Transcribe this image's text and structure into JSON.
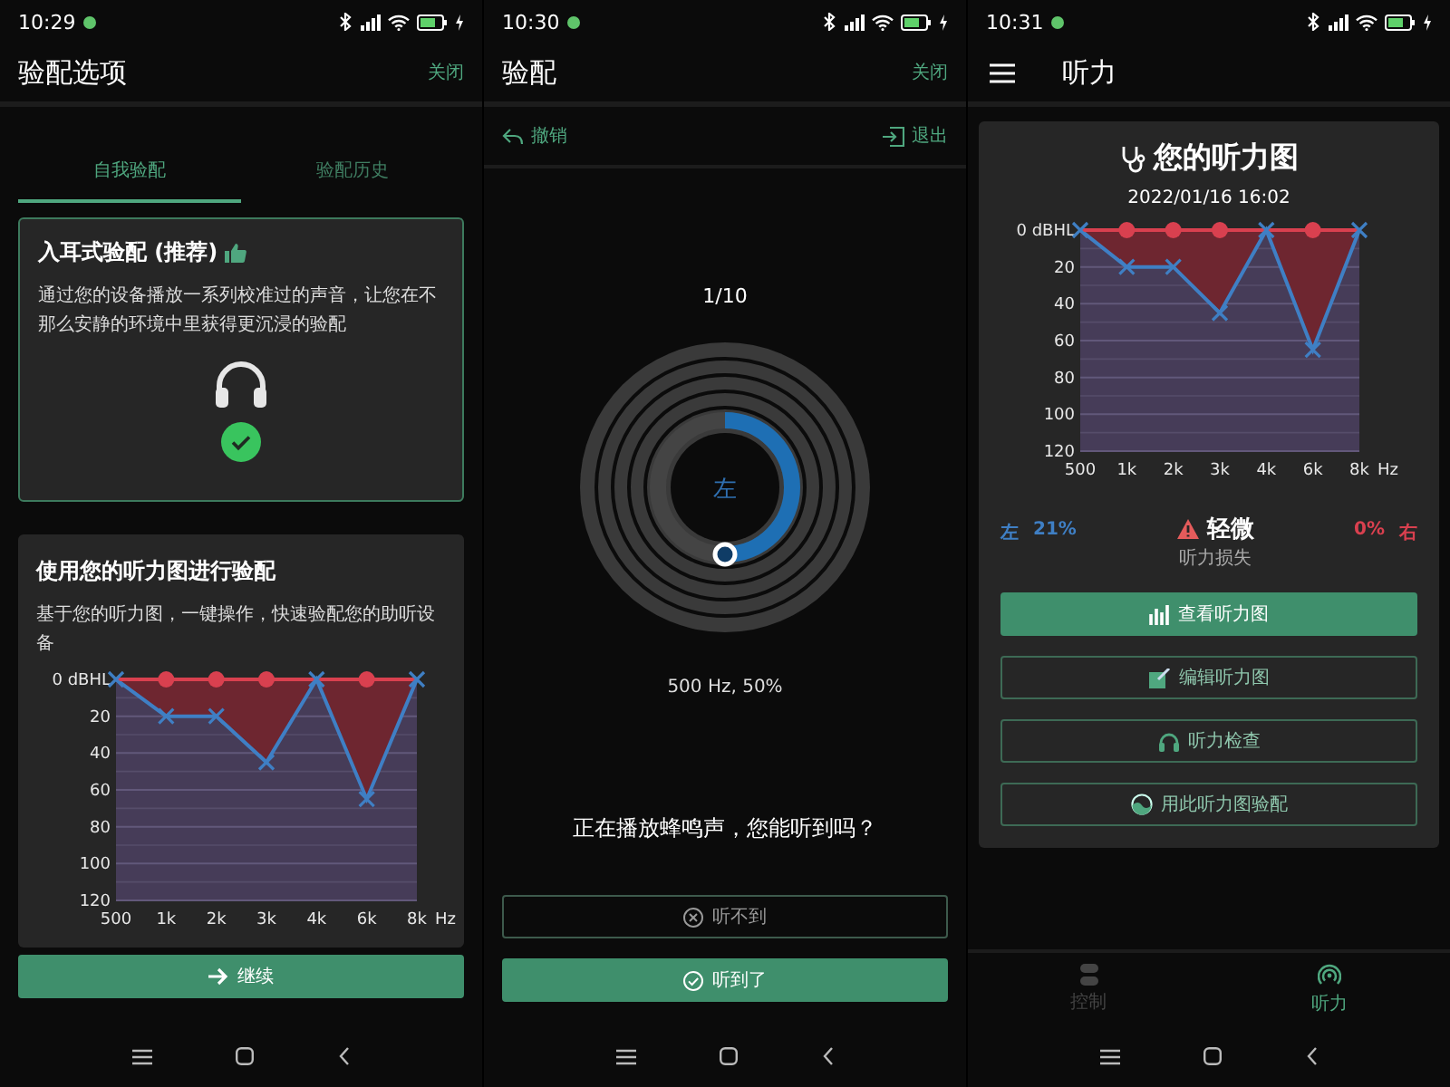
{
  "screens": [
    {
      "kind": "fitting_options",
      "status_bar": {
        "time": "10:29"
      },
      "header": {
        "title": "验配选项",
        "action": "关闭"
      },
      "tabs": [
        {
          "label": "自我验配",
          "selected": true
        },
        {
          "label": "验配历史",
          "selected": false
        }
      ],
      "option_card": {
        "title": "入耳式验配 (推荐)",
        "description": "通过您的设备播放一系列校准过的声音，让您在不那么安静的环境中里获得更沉浸的验配",
        "selected": true
      },
      "audiogram_card": {
        "title": "使用您的听力图进行验配",
        "description": "基于您的听力图，一键操作，快速验配您的助听设备",
        "chart_data": {
          "type": "line",
          "xlabel": "Hz",
          "categories": [
            "500",
            "1k",
            "2k",
            "3k",
            "4k",
            "6k",
            "8k"
          ],
          "series": [
            {
              "color": "#3f7fc4",
              "marker": "cross",
              "values": [
                0,
                20,
                20,
                45,
                0,
                65,
                0
              ]
            },
            {
              "color": "#d9404f",
              "marker": "circle",
              "values": [
                0,
                0,
                0,
                0,
                0,
                0,
                0
              ]
            }
          ],
          "grid": true,
          "ylim": [
            120,
            0
          ],
          "yticks": [
            {
              "value": 0,
              "label": "0 dBHL"
            },
            20,
            40,
            60,
            80,
            100,
            120
          ]
        }
      },
      "continue_button": "继续"
    },
    {
      "kind": "fitting_test",
      "status_bar": {
        "time": "10:30"
      },
      "header": {
        "title": "验配",
        "action": "关闭"
      },
      "toolbar": {
        "undo": "撤销",
        "exit": "退出"
      },
      "progress": "1/10",
      "dial": {
        "ear": "左",
        "level": 0.5
      },
      "reading": "500 Hz, 50%",
      "question": "正在播放蜂鸣声，您能听到吗？",
      "buttons": [
        {
          "label": "听不到",
          "kind": "outline"
        },
        {
          "label": "听到了",
          "kind": "primary"
        }
      ]
    },
    {
      "kind": "hearing",
      "status_bar": {
        "time": "10:31"
      },
      "header": {
        "title": "听力"
      },
      "card": {
        "title": "您的听力图",
        "date": "2022/01/16 16:02",
        "chart_data": {
          "type": "line",
          "xlabel": "Hz",
          "categories": [
            "500",
            "1k",
            "2k",
            "3k",
            "4k",
            "6k",
            "8k"
          ],
          "series": [
            {
              "color": "#3f7fc4",
              "marker": "cross",
              "values": [
                0,
                20,
                20,
                45,
                0,
                65,
                0
              ]
            },
            {
              "color": "#d9404f",
              "marker": "circle",
              "values": [
                0,
                0,
                0,
                0,
                0,
                0,
                0
              ]
            }
          ],
          "grid": true,
          "ylim": [
            120,
            0
          ],
          "yticks": [
            {
              "value": 0,
              "label": "0 dBHL"
            },
            20,
            40,
            60,
            80,
            100,
            120
          ]
        },
        "summary": {
          "left_label": "左",
          "left_value": "21%",
          "severity": "轻微",
          "caption": "听力损失",
          "right_value": "0%",
          "right_label": "右"
        },
        "buttons": [
          {
            "label": "查看听力图",
            "kind": "primary"
          },
          {
            "label": "编辑听力图",
            "kind": "outline"
          },
          {
            "label": "听力检查",
            "kind": "outline"
          },
          {
            "label": "用此听力图验配",
            "kind": "outline"
          }
        ]
      },
      "bottom_tabs": [
        {
          "label": "控制",
          "selected": false
        },
        {
          "label": "听力",
          "selected": true
        }
      ]
    }
  ]
}
